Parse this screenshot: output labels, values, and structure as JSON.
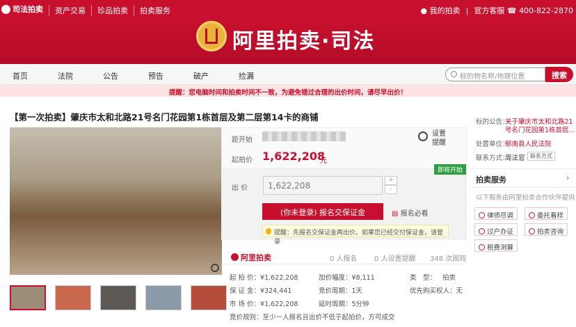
{
  "topbar": {
    "brand": "司法拍卖",
    "links": [
      "资产交易",
      "珍品拍卖",
      "拍卖服务"
    ],
    "my_auction": "我的拍卖",
    "service": "官方客服",
    "phone": "400-822-2870"
  },
  "banner": {
    "title": "阿里拍卖·司法"
  },
  "nav": {
    "items": [
      "首页",
      "法院",
      "公告",
      "预告",
      "破产",
      "捡漏"
    ],
    "search_placeholder": "标的物名称/地理位置",
    "search_button": "搜索"
  },
  "warning": "提醒：您电脑时间和拍卖时间不一致，为避免错过合理的出价时间，请尽早出价！",
  "title": "【第一次拍卖】肇庆市太和北路21号名门花园第1栋首层及第二层第14卡的商铺",
  "info": {
    "countdown_label": "距开始",
    "start_price_label": "起拍价",
    "start_price": "1,622,208",
    "unit": "元",
    "set_reminder": "设置提醒",
    "status_tag": "即将开始",
    "bid_label": "出 价",
    "bid_value": "1,622,208",
    "plus": "+",
    "minus": "-",
    "register_button": "(你未登录) 报名交保证金",
    "must_see": "报名必看",
    "tip": "提醒：先报名交保证金再出价。如果您已经交付保证金，请登录"
  },
  "stats": {
    "brand": "阿里拍卖",
    "applicants": "0",
    "applicants_label": "人报名",
    "reminders": "0",
    "reminders_label": "人设置提醒",
    "views": "348",
    "views_label": "次围观"
  },
  "details": {
    "start_price": "起 拍 价：¥1,622,208",
    "increment": "加价幅度：¥8,111",
    "type_label": "类　型：",
    "type_value": "拍卖",
    "deposit": "保 证 金：¥324,441",
    "period": "竞价周期：1天",
    "priority": "优先购买权人：无",
    "market": "市 场 价：¥1,622,208",
    "delay": "延时周期：5分钟",
    "rule": "竞价规则：至少一人报名且出价不低于起拍价，方可成交"
  },
  "side": {
    "notice_label": "标的公告：",
    "notice_text1": "关于肇庆市太和北路21",
    "notice_text2": "号名门花园第1栋首层...",
    "court_label": "处置单位：",
    "court": "郁南县人民法院",
    "contact_label": "联系方式：",
    "contact": "周法官",
    "contact_btn": "联系方式",
    "service_title": "拍卖服务",
    "service_sub": "以下服务由阿里拍卖合作伙伴提供",
    "buttons": [
      "律师尽调",
      "委托看样",
      "过户办证",
      "拍卖咨询",
      "税费测算"
    ]
  }
}
